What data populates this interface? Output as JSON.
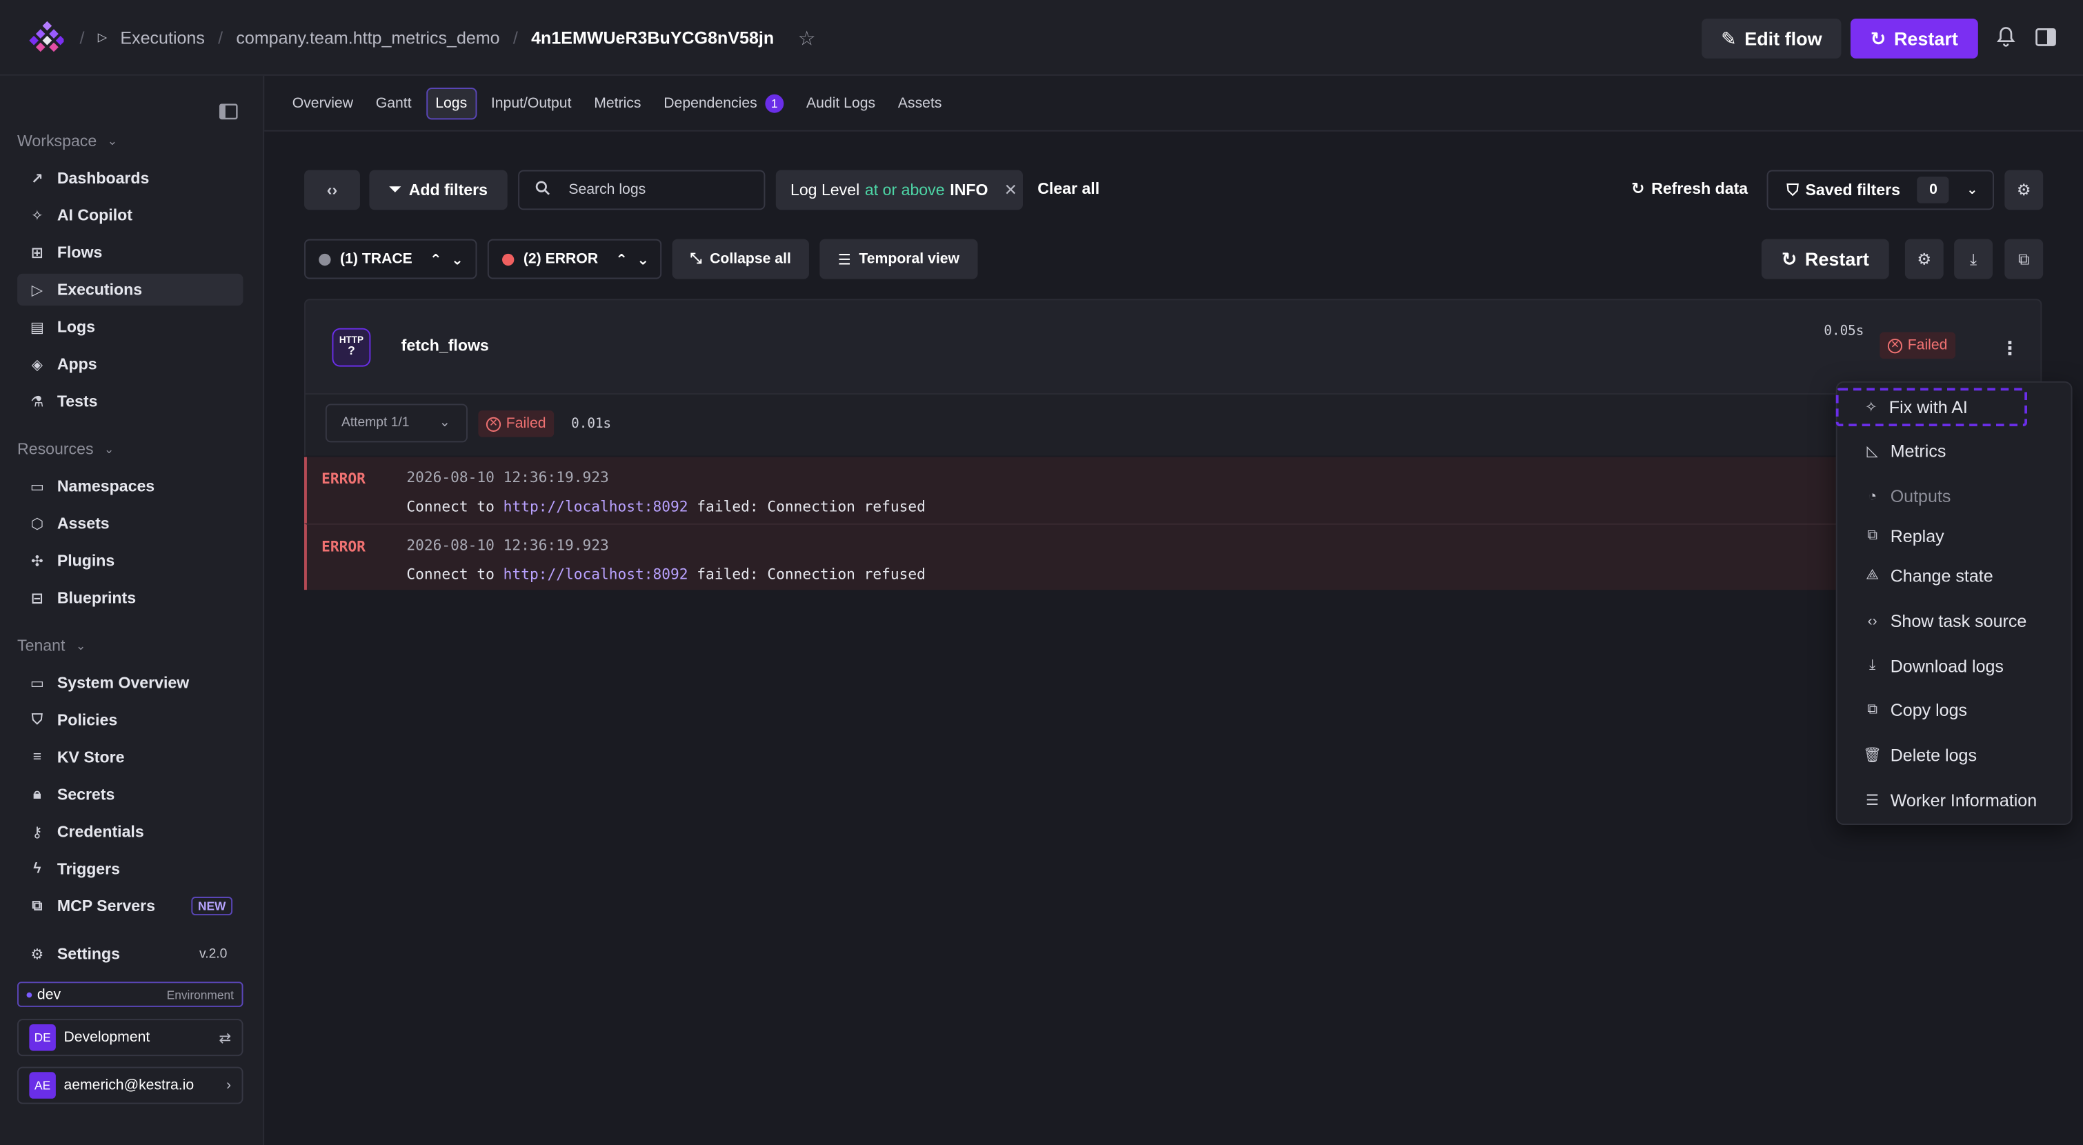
{
  "breadcrumb": {
    "executions": "Executions",
    "namespace": "company.team.http_metrics_demo",
    "execution_id": "4n1EMWUeR3BuYCG8nV58jn"
  },
  "header": {
    "edit_flow": "Edit flow",
    "restart": "Restart"
  },
  "sidebar": {
    "workspace_label": "Workspace",
    "workspace_items": [
      "Dashboards",
      "AI Copilot",
      "Flows",
      "Executions",
      "Logs",
      "Apps",
      "Tests"
    ],
    "resources_label": "Resources",
    "resources_items": [
      "Namespaces",
      "Assets",
      "Plugins",
      "Blueprints"
    ],
    "tenant_label": "Tenant",
    "tenant_items": [
      "System Overview",
      "Policies",
      "KV Store",
      "Secrets",
      "Credentials",
      "Triggers",
      "MCP Servers"
    ],
    "new_badge": "NEW",
    "settings": "Settings",
    "version": "v.2.0",
    "env_name": "dev",
    "env_label": "Environment",
    "tenant_avatar": "DE",
    "tenant_name": "Development",
    "user_avatar": "AE",
    "user_email": "aemerich@kestra.io"
  },
  "tabs": {
    "items": [
      "Overview",
      "Gantt",
      "Logs",
      "Input/Output",
      "Metrics",
      "Dependencies",
      "Audit Logs",
      "Assets"
    ],
    "active": "Logs",
    "dependencies_count": "1"
  },
  "filters": {
    "add_filters": "Add filters",
    "search_placeholder": "Search logs",
    "chip_key": "Log Level",
    "chip_op": "at or above",
    "chip_val": "INFO",
    "clear_all": "Clear all",
    "refresh": "Refresh data",
    "saved_filters": "Saved filters",
    "saved_count": "0"
  },
  "toolbar": {
    "trace": "(1) TRACE",
    "error": "(2) ERROR",
    "collapse_all": "Collapse all",
    "temporal_view": "Temporal view",
    "restart": "Restart"
  },
  "task": {
    "icon_line1": "HTTP",
    "icon_line2": "?",
    "name": "fetch_flows",
    "duration": "0.05s",
    "status": "Failed",
    "attempt": "Attempt 1/1",
    "attempt_status": "Failed",
    "attempt_duration": "0.01s"
  },
  "logs": [
    {
      "level": "ERROR",
      "timestamp": "2026-08-10 12:36:19.923",
      "msg_prefix": "Connect to ",
      "msg_link": "http://localhost:8092",
      "msg_suffix": " failed: Connection refused"
    },
    {
      "level": "ERROR",
      "timestamp": "2026-08-10 12:36:19.923",
      "msg_prefix": "Connect to ",
      "msg_link": "http://localhost:8092",
      "msg_suffix": " failed: Connection refused"
    }
  ],
  "menu": {
    "items": [
      "Fix with AI",
      "Metrics",
      "Outputs",
      "Replay",
      "Change state",
      "Show task source",
      "Download logs",
      "Copy logs",
      "Delete logs",
      "Worker Information"
    ]
  },
  "colors": {
    "accent": "#7b2ff2",
    "error": "#f07272",
    "trace_dot": "#8d8e99",
    "error_dot": "#f06060"
  }
}
